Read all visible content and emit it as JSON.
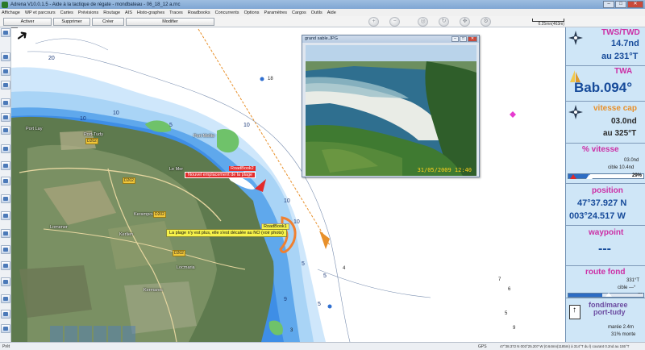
{
  "window": {
    "title": "Adrena V10.0.1.5 - Aide à la tactique de régate - mondbateau - 06_18_12 a.rnc"
  },
  "menu": [
    "Affichage",
    "WP et parcours",
    "Cartes",
    "Prévisions",
    "Routage",
    "AIS",
    "Histo-graphes",
    "Traces",
    "Roadbooks",
    "Concurrents",
    "Options",
    "Paramètres",
    "Cargos",
    "Outils",
    "Aide"
  ],
  "toolbar": {
    "buttons": [
      "Activer",
      "Supprimer",
      "Créer",
      "Modifier"
    ],
    "scale": "0.25mn(463m)"
  },
  "photo": {
    "title": "grand sable.JPG",
    "date": "31/05/2009 12:40"
  },
  "map_labels": {
    "roadbook2_head": "RoadBook2",
    "roadbook2_body": "Nouvel emplacement de la plage",
    "roadbook1_head": "RoadBook1",
    "roadbook1_body": "La plage n'y est plus, elle s'est décalée au NO (voir photo)",
    "places": [
      "Port Lay",
      "Port-Tudy",
      "Le Mer",
      "Kerampoulo",
      "Lomener",
      "Kerlien",
      "Locmaria",
      "Kermarec",
      "Port Melite"
    ],
    "roads": [
      "D202",
      "D202",
      "D202",
      "D202"
    ],
    "depths": [
      "20",
      "18",
      "10",
      "10",
      "10",
      "5",
      "10",
      "10",
      "5",
      "5",
      "4",
      "5",
      "7",
      "6",
      "5",
      "9",
      "9",
      "3"
    ]
  },
  "instruments": {
    "tws_label": "TWS/TWD",
    "tws_value": "14.7nd",
    "twd_value": "au 231°T",
    "twa_label": "TWA",
    "twa_value": "Bab.094°",
    "vcap_label": "vitesse cap",
    "vcap_value": "03.0nd",
    "vcap_dir": "au 325°T",
    "pvit_label": "% vitesse",
    "pvit_speed": "03.0nd",
    "pvit_target": "cible 10.4nd",
    "pvit_percent": "29%",
    "pvit_fraction": 0.29,
    "pos_label": "position",
    "pos_lat": "47°37.927 N",
    "pos_lon": "003°24.517 W",
    "wp_label": "waypoint",
    "wp_value": "---",
    "rf_label": "route fond",
    "rf_value": "331°T",
    "rf_target": "cible ---°",
    "rf_extra": "---",
    "tide_label": "fond/maree",
    "tide_port": "port-tudy",
    "tide_value": "marée 2.4m",
    "tide_trend": "31% monte"
  },
  "status": {
    "left": "Prêt",
    "gps": "GPS",
    "right": "47°38.372 N 003°25.207 W (0.64mn(1185m) à 314°T du l) courant 0.2nd au 155°T"
  },
  "colors": {
    "accent_magenta": "#cc2fa5",
    "value_blue": "#174b9a",
    "panel_bg": "#cfe6f7",
    "shallow_water": "#3e8ee6",
    "course_line": "#e8902a"
  }
}
